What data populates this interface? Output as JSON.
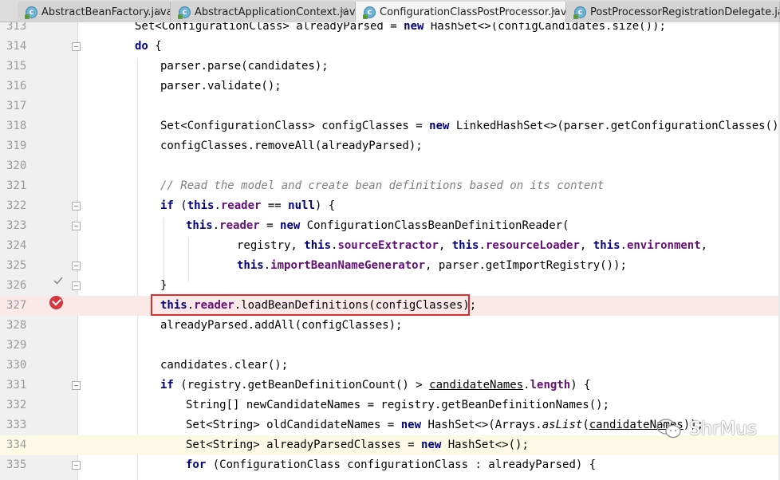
{
  "tabs": [
    {
      "label": "AbstractBeanFactory.java",
      "active": false,
      "icon": "class-icon",
      "close": "×"
    },
    {
      "label": "AbstractApplicationContext.java",
      "active": false,
      "icon": "class-icon",
      "close": "×"
    },
    {
      "label": "ConfigurationClassPostProcessor.java",
      "active": true,
      "icon": "class-icon",
      "close": "×"
    },
    {
      "label": "PostProcessorRegistrationDelegate.java",
      "active": false,
      "icon": "class-icon",
      "close": ""
    }
  ],
  "tab_icon_glyph": "c",
  "lines": [
    {
      "n": "313"
    },
    {
      "n": "314"
    },
    {
      "n": "315"
    },
    {
      "n": "316"
    },
    {
      "n": "317"
    },
    {
      "n": "318"
    },
    {
      "n": "319"
    },
    {
      "n": "320"
    },
    {
      "n": "321"
    },
    {
      "n": "322"
    },
    {
      "n": "323"
    },
    {
      "n": "324"
    },
    {
      "n": "325"
    },
    {
      "n": "326"
    },
    {
      "n": "327"
    },
    {
      "n": "328"
    },
    {
      "n": "329"
    },
    {
      "n": "330"
    },
    {
      "n": "331"
    },
    {
      "n": "332"
    },
    {
      "n": "333"
    },
    {
      "n": "334"
    },
    {
      "n": "335"
    }
  ],
  "code": {
    "l313": {
      "a": "Set<ConfigurationClass> alreadyParsed = ",
      "kw": "new",
      "b": " HashSet<>(configCandidates.size());"
    },
    "l314": {
      "kw": "do",
      "b": " {"
    },
    "l315": "parser.parse(candidates);",
    "l316": "parser.validate();",
    "l318": {
      "a": "Set<ConfigurationClass> configClasses = ",
      "kw": "new",
      "b": " LinkedHashSet<>(parser.getConfigurationClasses());"
    },
    "l319": "configClasses.removeAll(alreadyParsed);",
    "l321": "// Read the model and create bean definitions based on its content",
    "l322": {
      "kw1": "if",
      "a": " (",
      "kw2": "this",
      "dot": ".",
      "fld": "reader",
      "b": " == ",
      "kw3": "null",
      "c": ") {"
    },
    "l323": {
      "kw1": "this",
      "dot": ".",
      "fld": "reader",
      "a": " = ",
      "kw2": "new",
      "b": " ConfigurationClassBeanDefinitionReader("
    },
    "l324": {
      "a": "registry, ",
      "t1": "this",
      "f1": "sourceExtractor",
      "s1": ", ",
      "t2": "this",
      "f2": "resourceLoader",
      "s2": ", ",
      "t3": "this",
      "f3": "environment",
      "s3": ","
    },
    "l325": {
      "t1": "this",
      "f1": "importBeanNameGenerator",
      "a": ", parser.getImportRegistry());"
    },
    "l326": "}",
    "l327": {
      "kw": "this",
      "dot": ".",
      "fld": "reader",
      "a": ".loadBeanDefinitions(configClasses);"
    },
    "l328": "alreadyParsed.addAll(configClasses);",
    "l330": "candidates.clear();",
    "l331": {
      "kw": "if",
      "a": " (registry.getBeanDefinitionCount() > ",
      "u1": "candidateNames",
      "dot": ".",
      "fld": "length",
      "b": ") {"
    },
    "l332": "String[] newCandidateNames = registry.getBeanDefinitionNames();",
    "l333": {
      "a": "Set<String> oldCandidateNames = ",
      "kw": "new",
      "b": " HashSet<>(Arrays.",
      "it": "asList",
      "c": "(",
      "u1": "candidateNames",
      "d": "));"
    },
    "l334": {
      "a": "Set<String> alreadyParsedClasses = ",
      "kw": "new",
      "b": " HashSet<>();"
    },
    "l335": {
      "kw": "for",
      "a": " (ConfigurationClass configurationClass : alreadyParsed) {"
    }
  },
  "watermark": "ShrMus",
  "colors": {
    "keyword": "#000080",
    "field": "#660e7a",
    "comment": "#808080",
    "breakpoint": "#d3363f",
    "highlight_box": "#d9302b"
  }
}
